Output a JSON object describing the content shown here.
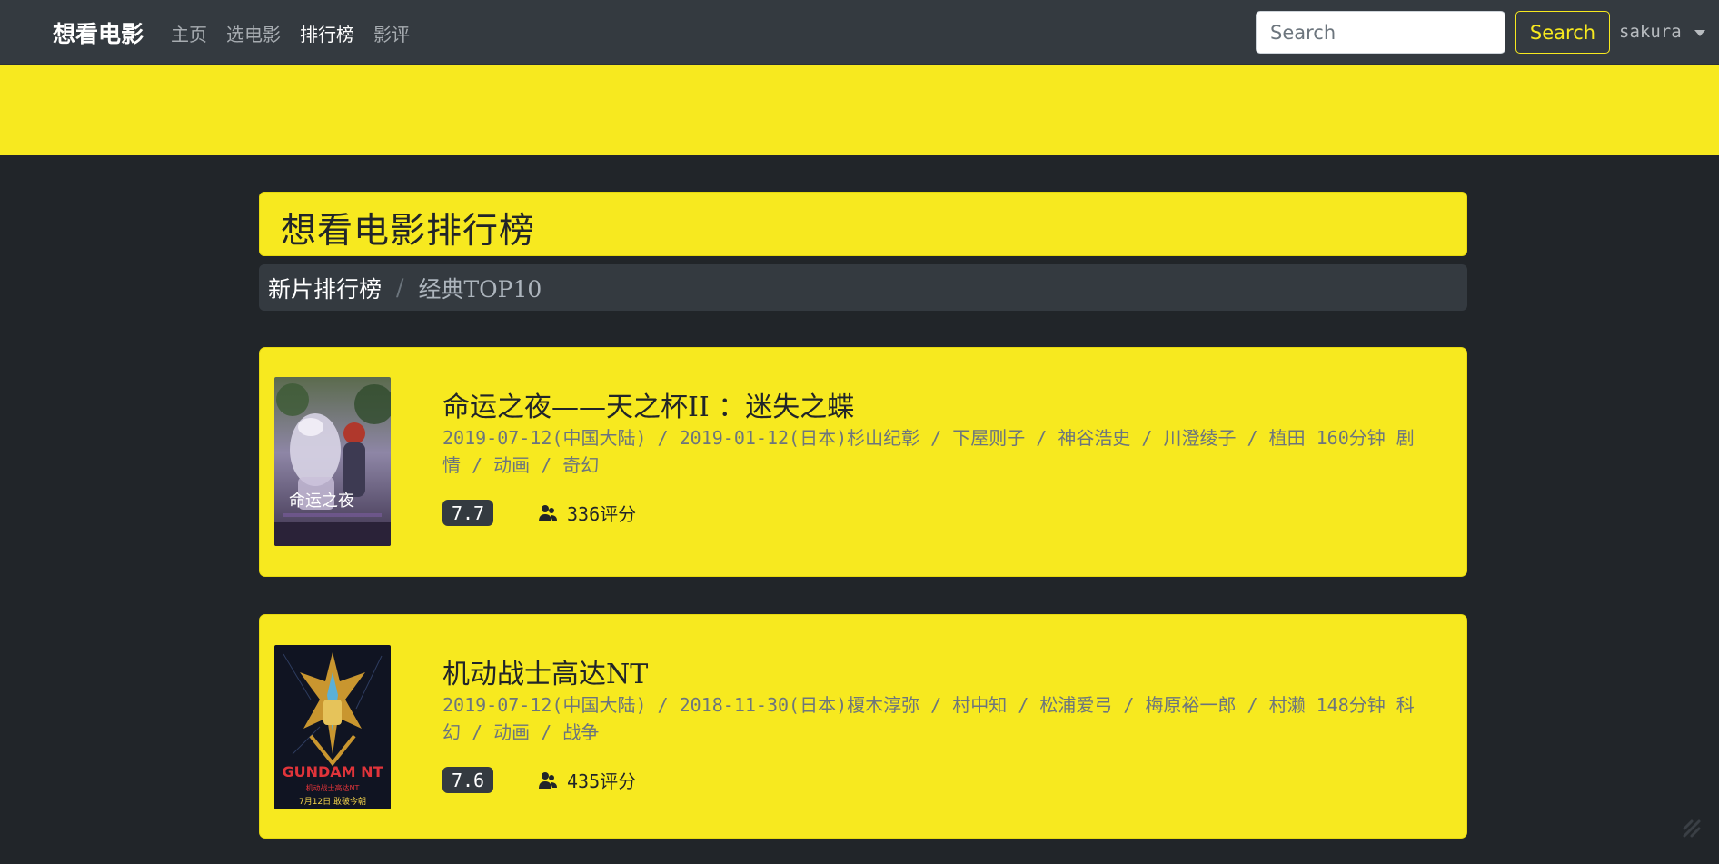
{
  "nav": {
    "brand": "想看电影",
    "links": [
      "主页",
      "选电影",
      "排行榜",
      "影评"
    ],
    "active_index": 2,
    "search_placeholder": "Search",
    "search_button": "Search",
    "user": "sakura"
  },
  "page": {
    "title": "想看电影排行榜",
    "breadcrumb": {
      "link": "新片排行榜",
      "separator": "/",
      "current": "经典TOP10"
    }
  },
  "movies": [
    {
      "title": "命运之夜——天之杯II ：迷失之蝶",
      "info_line1": "2019-07-12(中国大陆) / 2019-01-12(日本)杉山纪彰 / 下屋则子 / 神谷浩史 / 川澄绫子 / 植田 160分钟 剧",
      "info_line2": "情 / 动画 / 奇幻",
      "rating": "7.7",
      "votes": "336评分",
      "poster_icon": "anime-poster-fate"
    },
    {
      "title": "机动战士高达NT",
      "info_line1": "2019-07-12(中国大陆) / 2018-11-30(日本)榎木淳弥 / 村中知 / 松浦爱弓 / 梅原裕一郎 / 村濑 148分钟 科",
      "info_line2": "幻 / 动画 / 战争",
      "rating": "7.6",
      "votes": "435评分",
      "poster_icon": "anime-poster-gundam"
    }
  ],
  "colors": {
    "accent": "#f7e91f",
    "navbar": "#343a40",
    "background": "#212529"
  }
}
